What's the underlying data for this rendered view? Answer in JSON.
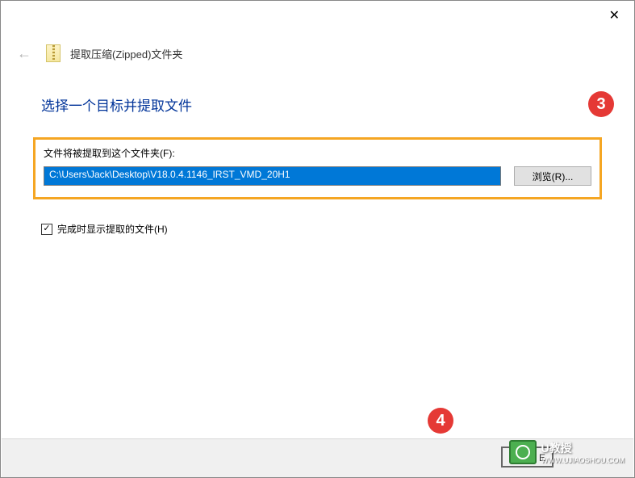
{
  "titlebar": {
    "close": "✕"
  },
  "header": {
    "title": "提取压缩(Zipped)文件夹"
  },
  "heading": "选择一个目标并提取文件",
  "folder": {
    "label": "文件将被提取到这个文件夹(F):",
    "path": "C:\\Users\\Jack\\Desktop\\V18.0.4.1146_IRST_VMD_20H1",
    "browse": "浏览(R)..."
  },
  "checkbox": {
    "checked": "✓",
    "label": "完成时显示提取的文件(H)"
  },
  "badges": {
    "three": "3",
    "four": "4"
  },
  "footer": {
    "extract_partial": "文 E"
  },
  "watermark": {
    "brand": "U教授",
    "sub": "WWW.UJIAOSHOU.COM"
  }
}
